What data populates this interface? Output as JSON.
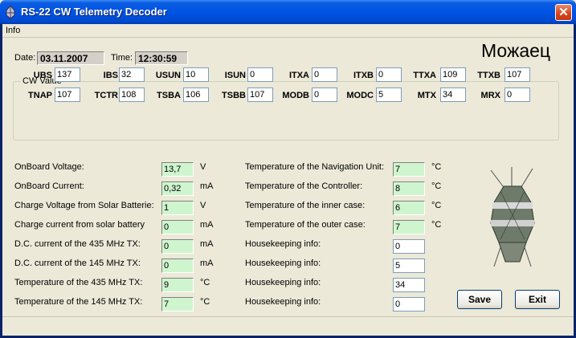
{
  "window": {
    "title": "RS-22 CW Telemetry Decoder",
    "close_glyph": "✕"
  },
  "menu": {
    "items": [
      "Info"
    ]
  },
  "header": {
    "date_label": "Date:",
    "date_value": "03.11.2007",
    "time_label": "Time:",
    "time_value": "12:30:59",
    "callsign": "Можаец"
  },
  "cw": {
    "title": "CW Value",
    "row1": [
      {
        "label": "UBS",
        "value": "137"
      },
      {
        "label": "IBS",
        "value": "32"
      },
      {
        "label": "USUN",
        "value": "10"
      },
      {
        "label": "ISUN",
        "value": "0"
      },
      {
        "label": "ITXA",
        "value": "0"
      },
      {
        "label": "ITXB",
        "value": "0"
      },
      {
        "label": "TTXA",
        "value": "109"
      },
      {
        "label": "TTXB",
        "value": "107"
      }
    ],
    "row2": [
      {
        "label": "TNAP",
        "value": "107"
      },
      {
        "label": "TCTR",
        "value": "108"
      },
      {
        "label": "TSBA",
        "value": "106"
      },
      {
        "label": "TSBB",
        "value": "107"
      },
      {
        "label": "MODB",
        "value": "0"
      },
      {
        "label": "MODC",
        "value": "5"
      },
      {
        "label": "MTX",
        "value": "34"
      },
      {
        "label": "MRX",
        "value": "0"
      }
    ]
  },
  "left": [
    {
      "label": "OnBoard Voltage:",
      "value": "13,7",
      "unit": "V"
    },
    {
      "label": "OnBoard Current:",
      "value": "0,32",
      "unit": "mA"
    },
    {
      "label": "Charge Voltage from Solar Batterie:",
      "value": "1",
      "unit": "V"
    },
    {
      "label": "Charge current from solar battery",
      "value": "0",
      "unit": "mA"
    },
    {
      "label": "D.C. current of the 435 MHz TX:",
      "value": "0",
      "unit": "mA"
    },
    {
      "label": "D.C. current of the 145 MHz TX:",
      "value": "0",
      "unit": "mA"
    },
    {
      "label": "Temperature of the 435 MHz TX:",
      "value": "9",
      "unit": "°C"
    },
    {
      "label": "Temperature of the 145 MHz TX:",
      "value": "7",
      "unit": "°C"
    }
  ],
  "right": [
    {
      "label": "Temperature of the Navigation Unit:",
      "value": "7",
      "unit": "°C"
    },
    {
      "label": "Temperature of the Controller:",
      "value": "8",
      "unit": "°C"
    },
    {
      "label": "Temperature of the inner case:",
      "value": "6",
      "unit": "°C"
    },
    {
      "label": "Temperature of the outer case:",
      "value": "7",
      "unit": "°C"
    },
    {
      "label": "Housekeeping info:",
      "value": "0",
      "unit": ""
    },
    {
      "label": "Housekeeping info:",
      "value": "5",
      "unit": ""
    },
    {
      "label": "Housekeeping info:",
      "value": "34",
      "unit": ""
    },
    {
      "label": "Housekeeping info:",
      "value": "0",
      "unit": ""
    }
  ],
  "buttons": {
    "save": "Save",
    "exit": "Exit"
  }
}
